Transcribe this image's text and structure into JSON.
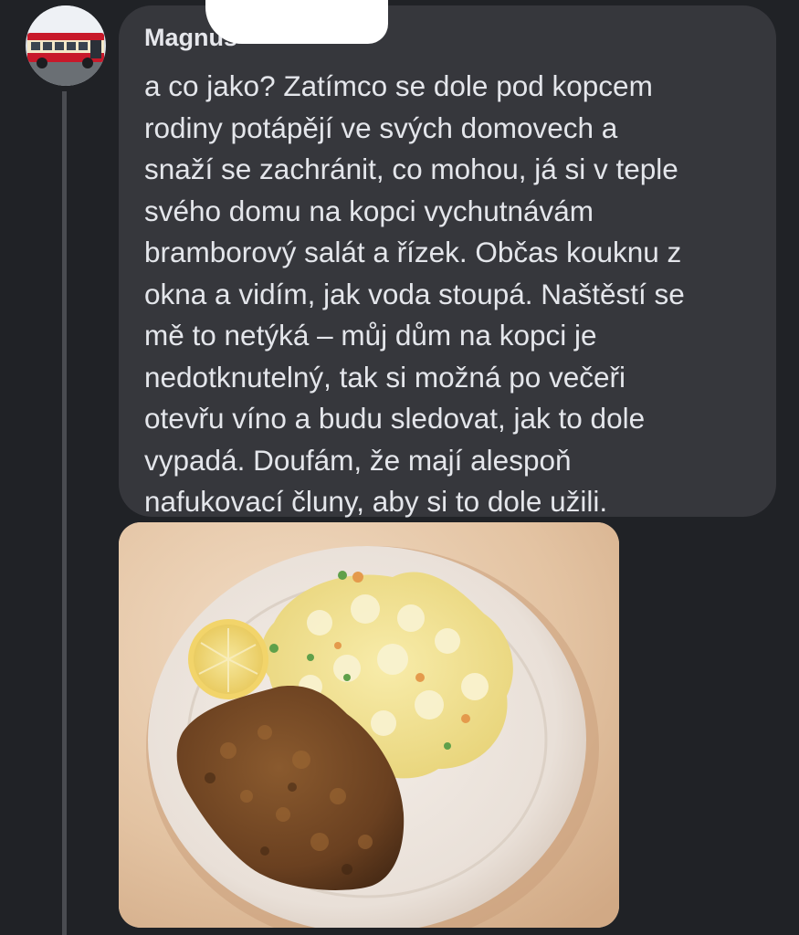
{
  "comment": {
    "author": "Magnus",
    "text_lines": [
      "a co jako? Zatímco se dole pod kopcem",
      "rodiny potápějí ve svých domovech a",
      "snaží se zachránit, co mohou, já si v teple",
      "svého domu na kopci vychutnávám",
      "bramborový salát a řízek. Občas kouknu z",
      "okna a vidím, jak voda stoupá. Naštěstí se",
      "mě to netýká – můj dům na kopci je",
      "nedotknutelný, tak si možná po večeři",
      "otevřu víno a budu sledovat, jak to dole",
      "vypadá. Doufám, že mají alespoň",
      "nafukovací čluny, aby si to dole užili."
    ]
  },
  "colors": {
    "background": "#202226",
    "bubble": "#36373c",
    "text": "#e4e6eb",
    "thread_line": "#4a4c51"
  }
}
